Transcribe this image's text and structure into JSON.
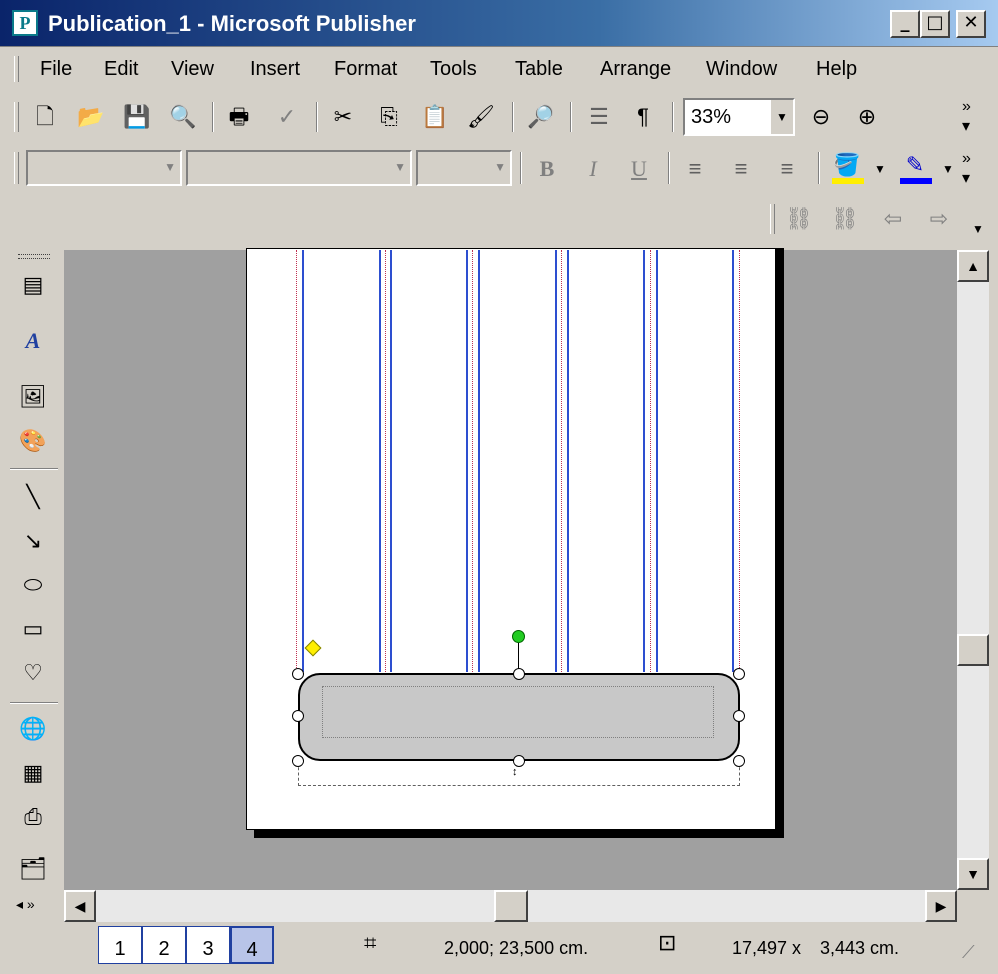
{
  "window": {
    "title": "Publication_1 - Microsoft Publisher",
    "app_icon": "publisher-icon",
    "controls": {
      "minimize": "_",
      "maximize": "□",
      "close": "✕"
    }
  },
  "menu": [
    "File",
    "Edit",
    "View",
    "Insert",
    "Format",
    "Tools",
    "Table",
    "Arrange",
    "Window",
    "Help"
  ],
  "standard_toolbar": {
    "icons": [
      "new-icon",
      "open-icon",
      "save-icon",
      "print-preview-icon",
      "print-icon",
      "spelling-icon",
      "cut-icon",
      "copy-icon",
      "paste-icon",
      "format-painter-icon",
      "zoom-page-icon",
      "columns-icon",
      "paragraph-icon",
      "zoom-out-icon",
      "zoom-in-icon",
      "more-icon"
    ],
    "zoom": "33%"
  },
  "formatting_toolbar": {
    "style": "",
    "font": "",
    "size": "",
    "bold": "B",
    "italic": "I",
    "underline": "U",
    "fill_color": "#ffee00",
    "line_color": "#0000ff"
  },
  "connect_toolbar": {
    "icons": [
      "link-icon",
      "unlink-icon",
      "previous-frame-icon",
      "next-frame-icon"
    ]
  },
  "pages": [
    "1",
    "2",
    "3",
    "4"
  ],
  "active_page": "4",
  "status": {
    "position": "2,000; 23,500 cm.",
    "size_w": "17,497 x",
    "size_h": "3,443 cm."
  }
}
